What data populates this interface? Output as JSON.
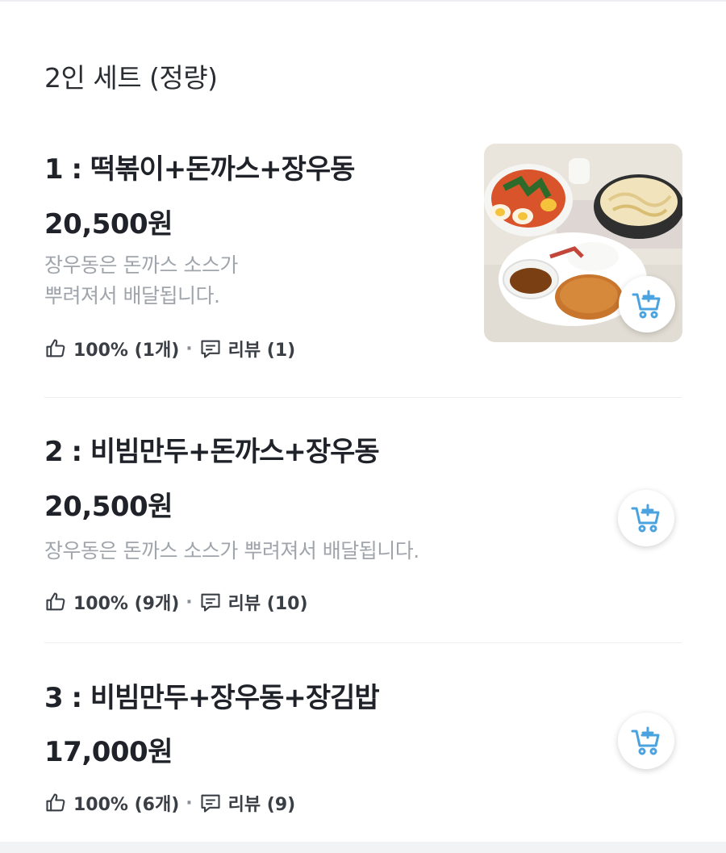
{
  "section": {
    "title": "2인 세트 (정량)"
  },
  "menu_items": [
    {
      "name": "1 : 떡볶이+돈까스+장우동",
      "price": "20,500원",
      "description_line1": "장우동은 돈까스 소스가",
      "description_line2": "뿌려져서 배달됩니다.",
      "like_text": "100% (1개)",
      "separator": "·",
      "review_text": "리뷰 (1)",
      "has_image": true
    },
    {
      "name": "2 : 비빔만두+돈까스+장우동",
      "price": "20,500원",
      "description_line1": "장우동은 돈까스 소스가 뿌려져서 배달됩니다.",
      "like_text": "100% (9개)",
      "separator": "·",
      "review_text": "리뷰 (10)",
      "has_image": false
    },
    {
      "name": "3 : 비빔만두+장우동+장김밥",
      "price": "17,000원",
      "like_text": "100% (6개)",
      "separator": "·",
      "review_text": "리뷰 (9)",
      "has_image": false
    }
  ],
  "icons": {
    "like": "thumbs-up-icon",
    "review": "speech-bubble-icon",
    "cart": "add-to-cart-icon"
  },
  "colors": {
    "accent": "#4aa3df",
    "text_primary": "#1f2329",
    "text_muted": "#a0a5ac"
  }
}
